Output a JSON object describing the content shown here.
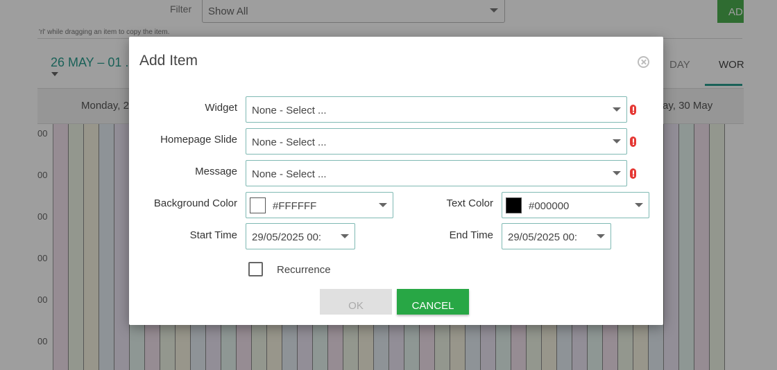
{
  "background": {
    "filter_label": "Filter",
    "filter_value": "Show All",
    "add_button_label": "AD",
    "drag_hint": "'rl' while dragging an item to copy the item.",
    "date_range": "26 MAY – 01 .",
    "view_tabs": [
      "DAY",
      "WOR"
    ],
    "day_headers": [
      "Monday, 2",
      "ay, 30 May"
    ],
    "time_labels": [
      "00",
      "00",
      "00",
      "00",
      "00",
      "00"
    ]
  },
  "dialog": {
    "title": "Add Item",
    "close_icon": "close-circle-icon",
    "fields": {
      "widget": {
        "label": "Widget",
        "value": "None - Select ..."
      },
      "homepage_slide": {
        "label": "Homepage Slide",
        "value": "None - Select ..."
      },
      "message": {
        "label": "Message",
        "value": "None - Select ..."
      },
      "background_color": {
        "label": "Background Color",
        "value": "#FFFFFF",
        "swatch": "#FFFFFF"
      },
      "text_color": {
        "label": "Text Color",
        "value": "#000000",
        "swatch": "#000000"
      },
      "start_time": {
        "label": "Start Time",
        "value": "29/05/2025 00:"
      },
      "end_time": {
        "label": "End Time",
        "value": "29/05/2025 00:"
      }
    },
    "recurrence_label": "Recurrence",
    "ok_label": "OK",
    "cancel_label": "CANCEL"
  },
  "colors": {
    "accent": "#2a9d8f",
    "required": "#e53935",
    "cancel": "#28a745",
    "field_border": "#7fb9b3"
  }
}
